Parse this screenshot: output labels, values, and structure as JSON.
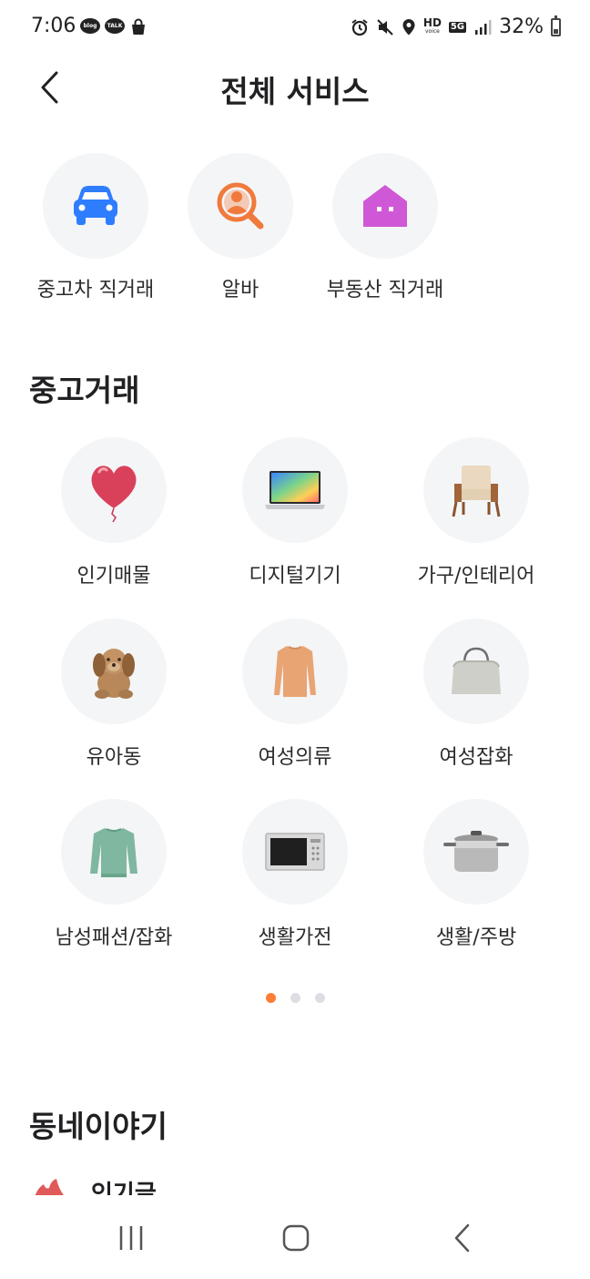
{
  "status_bar": {
    "time": "7:06",
    "notif_icons": [
      "blog-icon",
      "talk-icon",
      "shopping-bag-icon"
    ],
    "blog_label": "blog",
    "talk_label": "TALK",
    "hd_label": "HD",
    "hd_sub": "voice",
    "network": "5G",
    "battery": "32%"
  },
  "header": {
    "title": "전체 서비스"
  },
  "top_services": [
    {
      "label": "중고차 직거래",
      "icon": "car-icon",
      "color": "#2f7dff"
    },
    {
      "label": "알바",
      "icon": "job-search-icon",
      "color": "#f07a3c"
    },
    {
      "label": "부동산 직거래",
      "icon": "house-icon",
      "color": "#cf58d6"
    }
  ],
  "secondhand": {
    "title": "중고거래",
    "categories": [
      {
        "label": "인기매물",
        "icon": "heart-balloon-icon"
      },
      {
        "label": "디지털기기",
        "icon": "laptop-icon"
      },
      {
        "label": "가구/인테리어",
        "icon": "armchair-icon"
      },
      {
        "label": "유아동",
        "icon": "teddy-dog-icon"
      },
      {
        "label": "여성의류",
        "icon": "sweater-icon"
      },
      {
        "label": "여성잡화",
        "icon": "handbag-icon"
      },
      {
        "label": "남성패션/잡화",
        "icon": "mens-sweater-icon"
      },
      {
        "label": "생활가전",
        "icon": "microwave-icon"
      },
      {
        "label": "생활/주방",
        "icon": "cooking-pot-icon"
      }
    ],
    "page_count": 3,
    "active_page": 1
  },
  "neighborhood": {
    "title": "동네이야기",
    "first_item_label": "인기글"
  },
  "colors": {
    "accent": "#ff7e36",
    "circle_bg": "#f4f5f7"
  }
}
